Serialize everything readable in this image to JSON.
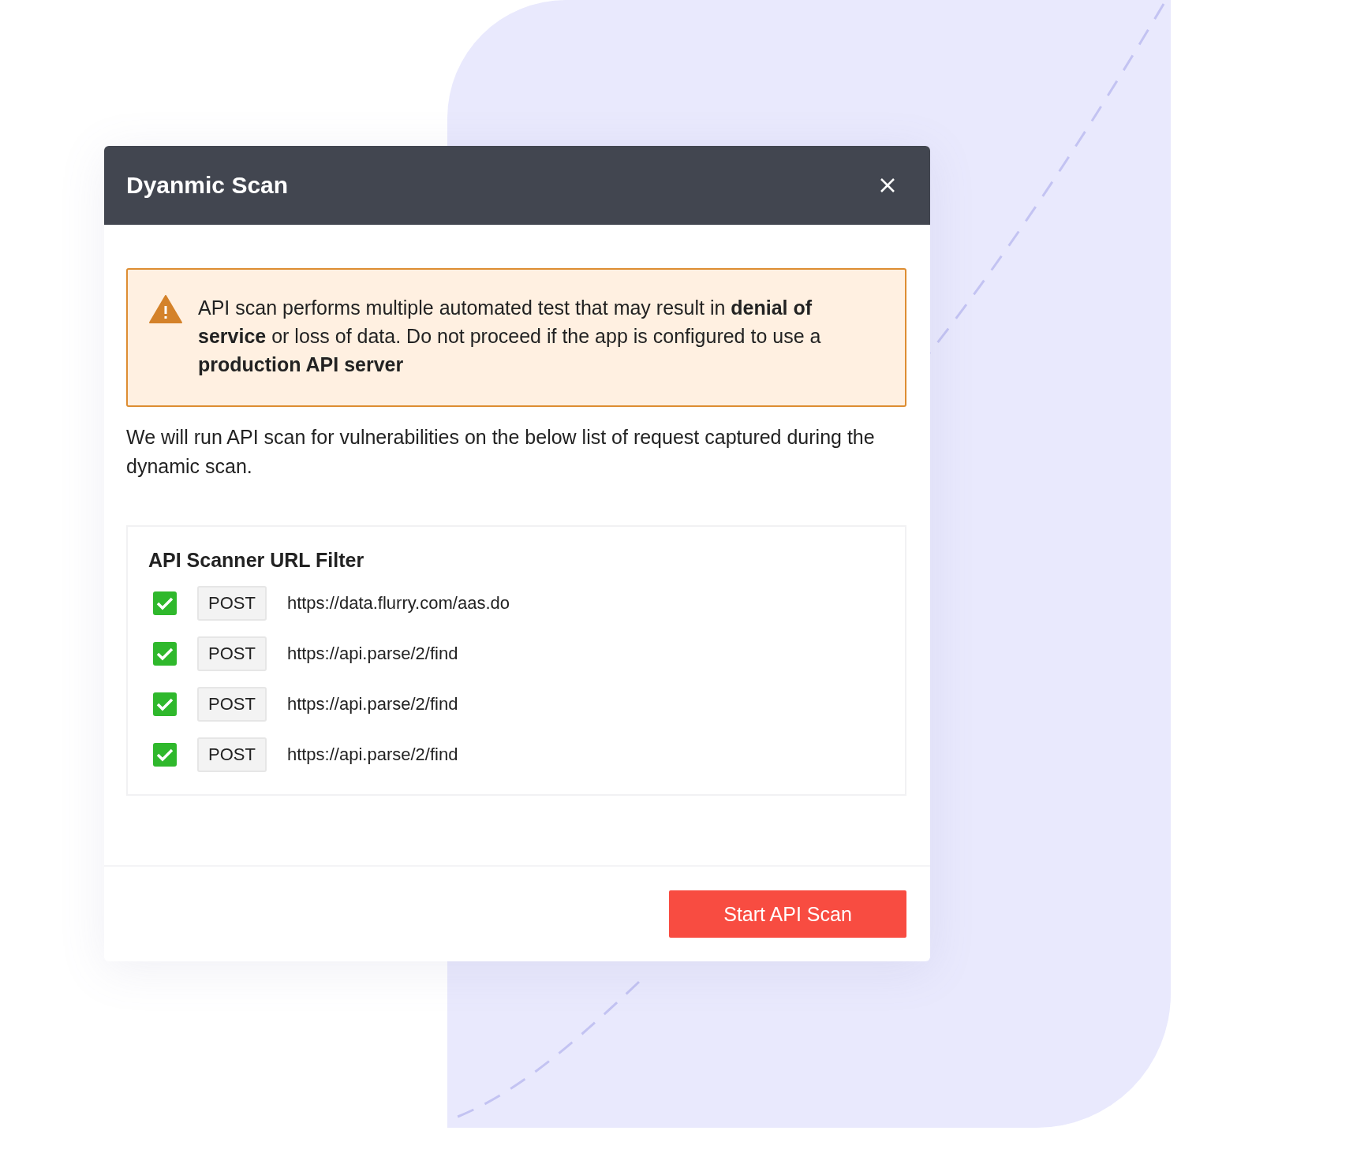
{
  "dialog": {
    "title": "Dyanmic Scan"
  },
  "alert": {
    "text": "API scan performs multiple automated test that may result in **denial of service** or loss of data. Do not proceed if the app is configured to use a **production API server**"
  },
  "description": "We will run API scan for vulnerabilities on the below list of request captured during the dynamic scan.",
  "url_filter": {
    "title": "API Scanner URL Filter",
    "items": [
      {
        "checked": true,
        "method": "POST",
        "url": "https://data.flurry.com/aas.do"
      },
      {
        "checked": true,
        "method": "POST",
        "url": "https://api.parse/2/find"
      },
      {
        "checked": true,
        "method": "POST",
        "url": "https://api.parse/2/find"
      },
      {
        "checked": true,
        "method": "POST",
        "url": "https://api.parse/2/find"
      }
    ]
  },
  "footer": {
    "button": "Start API Scan"
  }
}
